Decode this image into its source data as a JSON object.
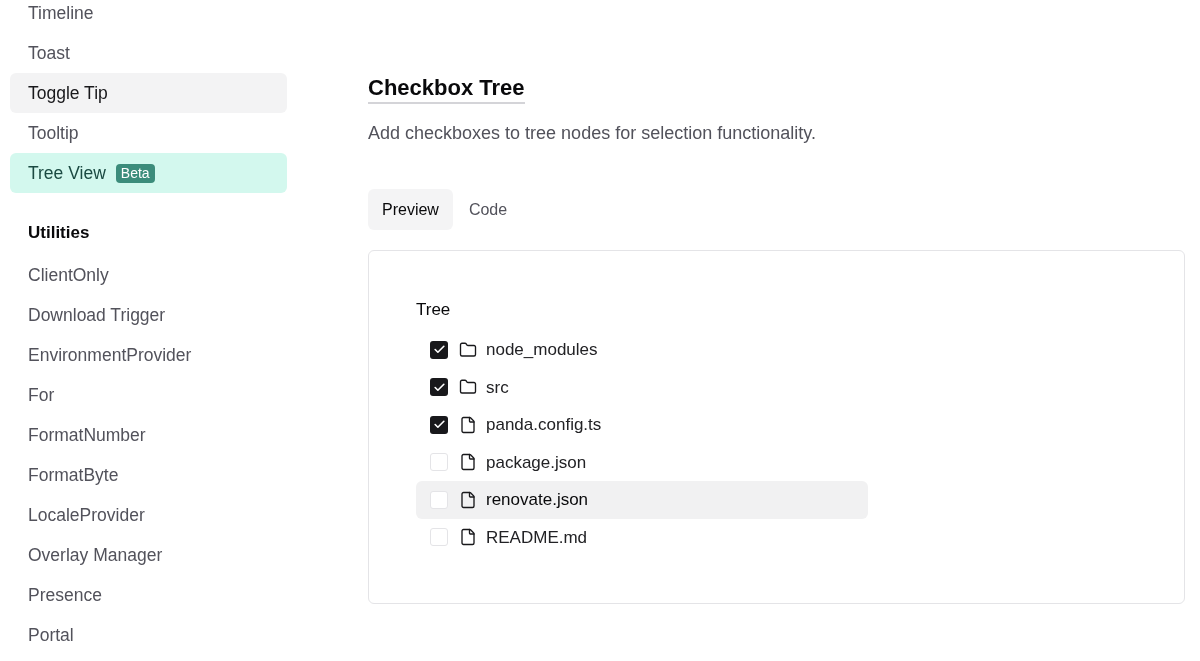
{
  "sidebar": {
    "groups": [
      {
        "items": [
          {
            "label": "Timeline",
            "selected": false,
            "hovered": false
          },
          {
            "label": "Toast",
            "selected": false,
            "hovered": false
          },
          {
            "label": "Toggle Tip",
            "selected": false,
            "hovered": true
          },
          {
            "label": "Tooltip",
            "selected": false,
            "hovered": false
          },
          {
            "label": "Tree View",
            "selected": true,
            "hovered": false,
            "badge": "Beta"
          }
        ]
      },
      {
        "title": "Utilities",
        "items": [
          {
            "label": "ClientOnly",
            "selected": false,
            "hovered": false
          },
          {
            "label": "Download Trigger",
            "selected": false,
            "hovered": false
          },
          {
            "label": "EnvironmentProvider",
            "selected": false,
            "hovered": false
          },
          {
            "label": "For",
            "selected": false,
            "hovered": false
          },
          {
            "label": "FormatNumber",
            "selected": false,
            "hovered": false
          },
          {
            "label": "FormatByte",
            "selected": false,
            "hovered": false
          },
          {
            "label": "LocaleProvider",
            "selected": false,
            "hovered": false
          },
          {
            "label": "Overlay Manager",
            "selected": false,
            "hovered": false
          },
          {
            "label": "Presence",
            "selected": false,
            "hovered": false
          },
          {
            "label": "Portal",
            "selected": false,
            "hovered": false
          }
        ]
      }
    ]
  },
  "page": {
    "title": "Checkbox Tree",
    "description": "Add checkboxes to tree nodes for selection functionality."
  },
  "tabs": [
    {
      "label": "Preview",
      "selected": true
    },
    {
      "label": "Code",
      "selected": false
    }
  ],
  "preview": {
    "tree": {
      "label": "Tree",
      "nodes": [
        {
          "kind": "folder",
          "label": "node_modules",
          "checked": true,
          "hovered": false
        },
        {
          "kind": "folder",
          "label": "src",
          "checked": true,
          "hovered": false
        },
        {
          "kind": "file",
          "label": "panda.config.ts",
          "checked": true,
          "hovered": false
        },
        {
          "kind": "file",
          "label": "package.json",
          "checked": false,
          "hovered": false
        },
        {
          "kind": "file",
          "label": "renovate.json",
          "checked": false,
          "hovered": true
        },
        {
          "kind": "file",
          "label": "README.md",
          "checked": false,
          "hovered": false
        }
      ]
    }
  }
}
